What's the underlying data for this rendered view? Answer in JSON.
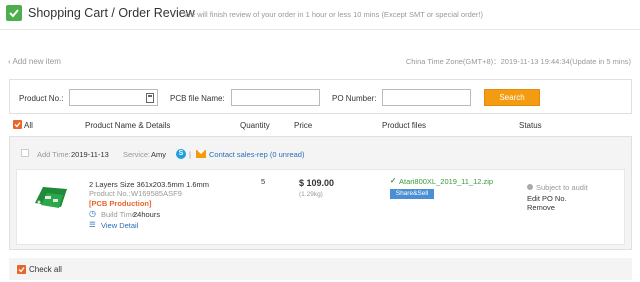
{
  "header": {
    "title": "Shopping Cart / Order Review",
    "subtitle": "We will finish review of your order in 1 hour or less 10 mins (Except SMT or special order!)"
  },
  "add_new": "‹ Add new item",
  "timezone": "China Time Zone(GMT+8)：2019-11-13 19:44:34(Update in 5 mins)",
  "search": {
    "product_no_label": "Product No.:",
    "product_no_value": "",
    "pcb_file_label": "PCB file Name:",
    "pcb_file_value": "",
    "po_label": "PO Number:",
    "po_value": "",
    "button": "Search"
  },
  "columns": {
    "all": "All",
    "product": "Product Name & Details",
    "quantity": "Quantity",
    "price": "Price",
    "files": "Product files",
    "status": "Status"
  },
  "order": {
    "add_time_label": "Add Time:",
    "add_time": "2019-11-13",
    "service_label": "Service:",
    "service_name": "Amy",
    "separator": "|",
    "contact": "Contact sales-rep (0 unread)",
    "item": {
      "name": "2 Layers Size 361x203.5mm 1.6mm",
      "product_no_label": "Product No.:",
      "product_no": "W169585ASF9",
      "category": "[PCB Production]",
      "build_time_label": "Build Time:",
      "build_time": "24hours",
      "view_detail": "View Detail",
      "quantity": "5",
      "price": "$ 109.00",
      "weight": "(1.29kg)",
      "file": "Atari800XL_2019_11_12.zip",
      "share": "Share&Sell",
      "status": "Subject to audit",
      "edit": "Edit PO No.",
      "remove": "Remove"
    }
  },
  "check_all": "Check all",
  "colors": {
    "accent_green": "#4cae4c",
    "accent_orange": "#e8652b",
    "button_orange": "#f39c12",
    "link_blue": "#2a6ebb"
  }
}
